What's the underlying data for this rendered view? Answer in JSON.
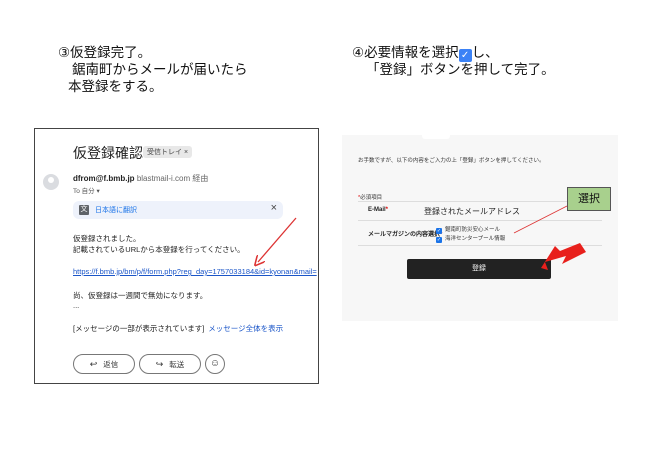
{
  "steps": {
    "step3": [
      "③仮登録完了。",
      "鋸南町からメールが届いたら",
      "本登録をする。"
    ],
    "step4": {
      "line1": "④必要情報を選択",
      "check": "✓",
      "line1_end": "し、",
      "line2": "「登録」ボタンを押して完了。"
    }
  },
  "email": {
    "subject": "仮登録確認",
    "badge": "受信トレイ ×",
    "sender_address": "dfrom@f.bmb.jp",
    "sender_via": "blastmail-i.com 経由",
    "to": "To 自分 ▾",
    "translate_icon": "文",
    "translate_label": "日本語に翻訳",
    "translate_close": "×",
    "body_lines": [
      "仮登録されました。",
      "記載されているURLから本登録を行ってください。"
    ],
    "link": "https://f.bmb.jp/bm/p/f/form.php?reg_day=1757033184&id=kyonan&mail=",
    "expire_note": "尚、仮登録は一週間で無効になります。",
    "ellipsis": "...",
    "truncated_notice": "[メッセージの一部が表示されています]",
    "show_all": "メッセージ全体を表示",
    "reply_label": "返信",
    "forward_label": "転送",
    "reply_glyph": "↩",
    "forward_glyph": "↪",
    "emoji_glyph": "☺"
  },
  "form": {
    "intro": "お手数ですが、以下の内容をご入力の上「登録」ボタンを押してください。",
    "required_star": "*",
    "required_label": "必須項目",
    "email_label": "E-Mail",
    "email_star": "*",
    "email_value": "登録されたメールアドレス",
    "magazine_label": "メールマガジンの内容選択",
    "magazine_star": "*",
    "options": [
      "鋸南町防災安心メール",
      "海洋センタープール情報"
    ],
    "option_check": "✓",
    "submit_label": "登録"
  },
  "callout": {
    "label": "選択"
  },
  "colors": {
    "red_arrow": "#e8201c",
    "callout_bg": "#a8d08d",
    "link": "#1a55c8"
  }
}
